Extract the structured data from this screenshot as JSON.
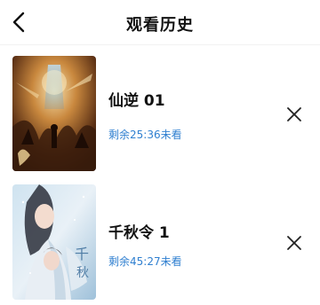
{
  "header": {
    "title": "观看历史",
    "back_icon": "chevron-left-icon"
  },
  "history": {
    "items": [
      {
        "title": "仙逆 01",
        "progress_text": "剩余25:36未看",
        "poster_icon": "poster-xianni",
        "remove_icon": "close-icon"
      },
      {
        "title": "千秋令 1",
        "progress_text": "剩余45:27未看",
        "poster_icon": "poster-qianqiuling",
        "remove_icon": "close-icon"
      }
    ]
  },
  "colors": {
    "progress_text": "#2f7fd0",
    "title_text": "#111111"
  }
}
